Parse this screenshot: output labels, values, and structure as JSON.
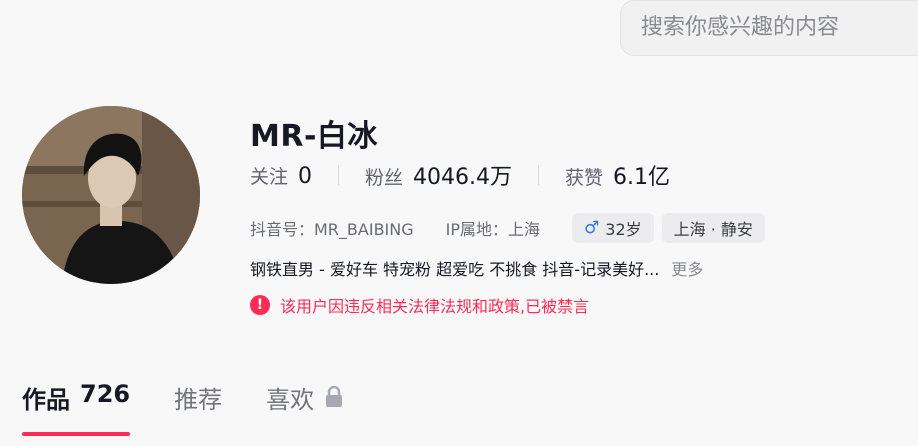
{
  "search": {
    "placeholder": "搜索你感兴趣的内容"
  },
  "profile": {
    "name": "MR-白冰",
    "stats": [
      {
        "label": "关注",
        "value": "0"
      },
      {
        "label": "粉丝",
        "value": "4046.4万"
      },
      {
        "label": "获赞",
        "value": "6.1亿"
      }
    ],
    "douyin_id": "抖音号：MR_BAIBING",
    "ip_location": "IP属地：上海",
    "age_tag": "32岁",
    "location_tag": "上海 · 静安",
    "bio": "钢铁直男 - 爱好车 特宠粉 超爱吃 不挑食 抖音-记录美好...",
    "more_label": "更多",
    "warning": "该用户因违反相关法律法规和政策,已被禁言"
  },
  "tabs": [
    {
      "label": "作品",
      "count": "726"
    },
    {
      "label": "推荐"
    },
    {
      "label": "喜欢"
    }
  ],
  "colors": {
    "accent": "#fe2c55",
    "male": "#2979d9",
    "text": "#161823",
    "muted": "#6a6b73"
  },
  "icons": {
    "warning": "exclamation-circle-icon",
    "male": "male-symbol-icon",
    "lock": "lock-icon"
  }
}
